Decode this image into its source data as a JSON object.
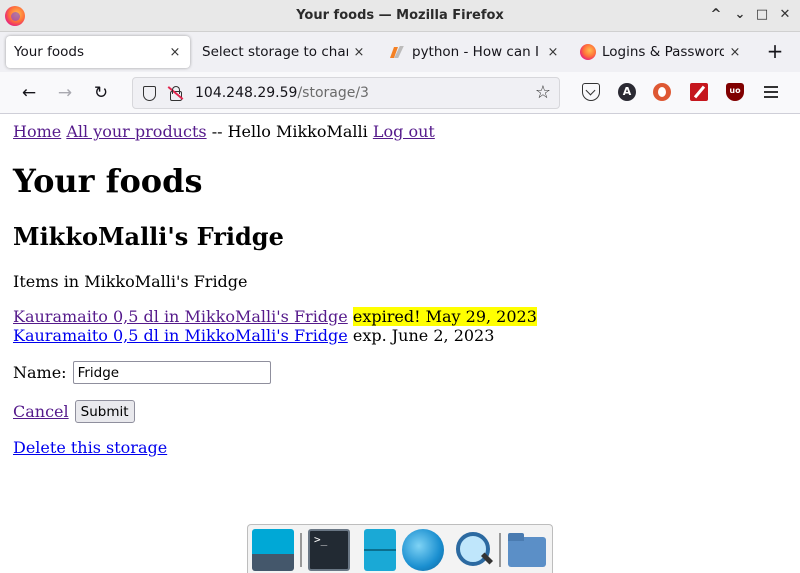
{
  "window": {
    "title": "Your foods — Mozilla Firefox",
    "controls": [
      "^",
      "⌄",
      "□",
      "✕"
    ]
  },
  "tabs": [
    {
      "label": "Your foods",
      "favicon": "none",
      "active": true
    },
    {
      "label": "Select storage to change",
      "favicon": "none",
      "active": false
    },
    {
      "label": "python - How can I",
      "favicon": "stackoverflow-icon",
      "active": false
    },
    {
      "label": "Logins & Passwords",
      "favicon": "firefox-icon",
      "active": false
    }
  ],
  "tab_close_glyph": "×",
  "newtab_glyph": "+",
  "nav": {
    "back": "←",
    "forward": "→",
    "reload": "↻",
    "url_host": "104.248.29.59",
    "url_path": "/storage/3",
    "bookmark": "☆",
    "account_initial": "A",
    "ublock_label": "uo"
  },
  "page": {
    "nav_links": {
      "home": "Home",
      "products": "All your products",
      "greeting": "-- Hello MikkoMalli",
      "logout": "Log out"
    },
    "title": "Your foods",
    "storage_title": "MikkoMalli's Fridge",
    "items_label": "Items in MikkoMalli's Fridge",
    "items": [
      {
        "link": "Kauramaito 0,5 dl in MikkoMalli's Fridge",
        "status": "expired! May 29, 2023",
        "expired": true
      },
      {
        "link": "Kauramaito 0,5 dl in MikkoMalli's Fridge",
        "status": "exp. June 2, 2023",
        "expired": false
      }
    ],
    "form": {
      "name_label": "Name:",
      "name_value": "Fridge",
      "cancel": "Cancel",
      "submit": "Submit"
    },
    "delete_link": "Delete this storage"
  },
  "colors": {
    "link": "#0000ee",
    "visited_link": "#551a8b",
    "expired_highlight": "#ffff00"
  },
  "dock": [
    "desktop-icon",
    "terminal-icon",
    "file-cabinet-icon",
    "web-browser-icon",
    "search-tool-icon",
    "folder-icon"
  ]
}
